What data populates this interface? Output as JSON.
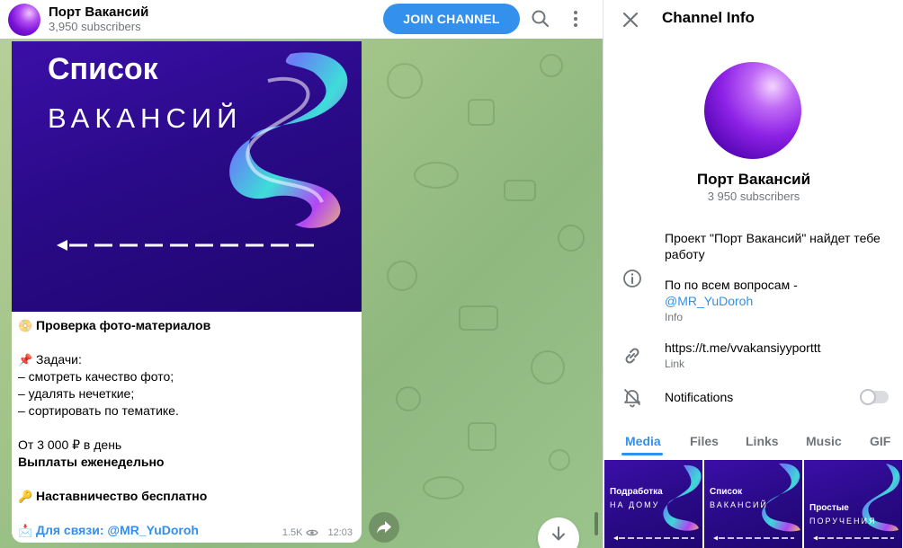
{
  "chat": {
    "title": "Порт Вакансий",
    "subscribers": "3,950 subscribers",
    "join_label": "JOIN CHANNEL",
    "icons": [
      "search-icon",
      "more-vertical-icon",
      "share-icon",
      "arrow-down-icon"
    ]
  },
  "message": {
    "image": {
      "title": "Список",
      "subtitle": "ВАКАНСИЙ"
    },
    "lines": [
      {
        "emoji": "📀",
        "text": "Проверка фото-материалов",
        "bold": true
      },
      {
        "emoji": "",
        "text": "",
        "bold": false
      },
      {
        "emoji": "📌",
        "text": "Задачи:",
        "bold": false
      },
      {
        "emoji": "",
        "text": "– смотреть качество фото;",
        "bold": false
      },
      {
        "emoji": "",
        "text": "– удалять нечеткие;",
        "bold": false
      },
      {
        "emoji": "",
        "text": "– сортировать по тематике.",
        "bold": false
      },
      {
        "emoji": "",
        "text": "",
        "bold": false
      },
      {
        "emoji": "",
        "text": "От 3 000 ₽ в день",
        "bold": false
      },
      {
        "emoji": "",
        "text": "Выплаты еженедельно",
        "bold": true
      },
      {
        "emoji": "",
        "text": "",
        "bold": false
      },
      {
        "emoji": "🔑",
        "text": "Наставничество бесплатно",
        "bold": true
      },
      {
        "emoji": "",
        "text": "",
        "bold": false
      }
    ],
    "contact": {
      "emoji": "📩",
      "text": "Для связи: @MR_YuDoroh"
    },
    "views": "1.5K",
    "time": "12:03"
  },
  "panel": {
    "title": "Channel Info",
    "name": "Порт Вакансий",
    "subscribers": "3 950 subscribers",
    "description_line1": "Проект \"Порт Вакансий\" найдет тебе",
    "description_line2": "работу",
    "description_line3": "По по всем вопросам -",
    "description_mention": "@MR_YuDoroh",
    "info_caption": "Info",
    "link": "https://t.me/vvakansiyyporttt",
    "link_caption": "Link",
    "notifications_label": "Notifications",
    "notifications_on": false,
    "tabs": [
      "Media",
      "Files",
      "Links",
      "Music",
      "GIF"
    ],
    "active_tab": "Media",
    "media": [
      {
        "t1": "Подработка",
        "t2": "НА ДОМУ"
      },
      {
        "t1": "Список",
        "t2": "ВАКАНСИЙ"
      },
      {
        "t1": "Простые",
        "t2": "ПОРУЧЕНИЯ"
      }
    ]
  },
  "colors": {
    "accent": "#3390ec",
    "chat_bg": "#9ec48a",
    "image_bg": "#2a0a88"
  }
}
